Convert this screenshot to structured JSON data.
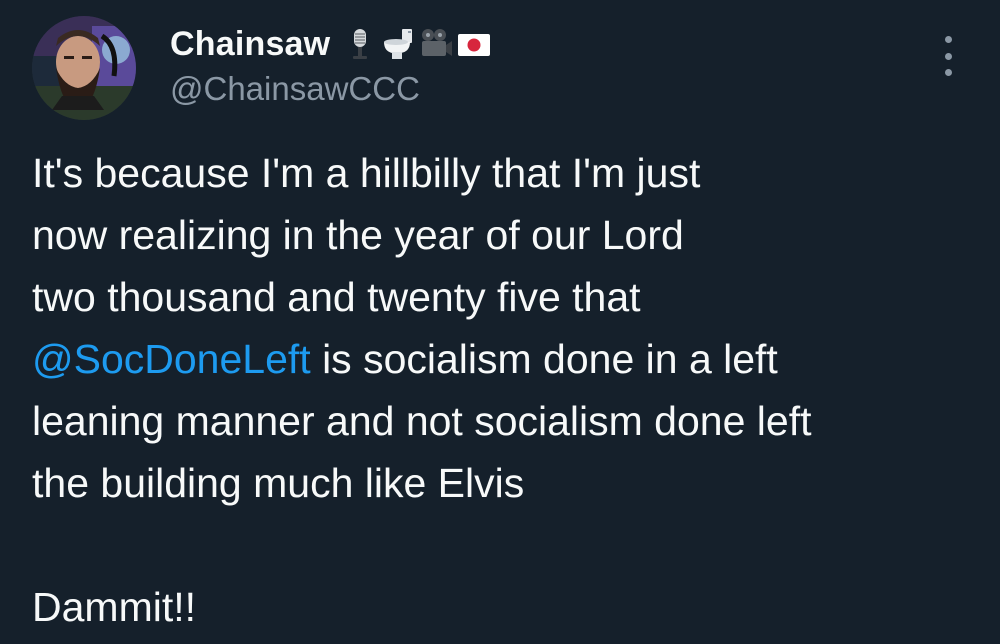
{
  "author": {
    "display_name": "Chainsaw",
    "handle": "@ChainsawCCC",
    "name_emojis": [
      "microphone-emoji",
      "toilet-emoji",
      "movie-camera-emoji",
      "japan-flag-emoji"
    ]
  },
  "tweet": {
    "lines": [
      "It's because I'm a hillbilly that I'm just",
      "now realizing in the year of our Lord",
      "two thousand and twenty five that"
    ],
    "mention": "@SocDoneLeft",
    "mention_line_rest": " is socialism done in a left",
    "lines_after": [
      "leaning manner and not socialism done left",
      "the building much like Elvis"
    ],
    "closing": "Dammit!!"
  },
  "colors": {
    "background": "#15202b",
    "text": "#f7f9f9",
    "secondary": "#8b98a5",
    "link": "#1d9bf0"
  }
}
